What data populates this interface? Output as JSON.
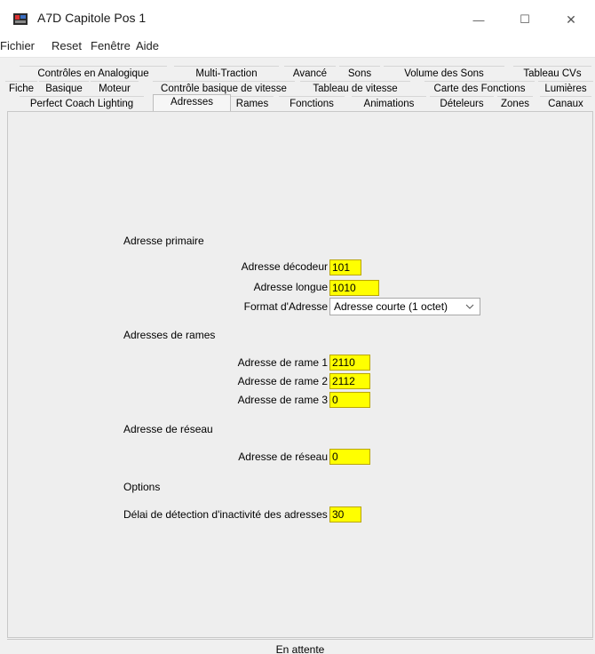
{
  "window": {
    "title": "A7D Capitole Pos 1",
    "minimize_label": "—",
    "maximize_label": "☐",
    "close_label": "✕"
  },
  "menu": [
    "Fichier",
    "Reset",
    "Fenêtre",
    "Aide"
  ],
  "tabs": {
    "row1": [
      "Contrôles en Analogique",
      "Multi-Traction",
      "Avancé",
      "Sons",
      "Volume des Sons",
      "Tableau CVs"
    ],
    "row2": [
      "Fiche",
      "Basique",
      "Moteur",
      "Contrôle basique de vitesse",
      "Tableau de vitesse",
      "Carte des Fonctions",
      "Lumières"
    ],
    "row3": [
      "Perfect Coach Lighting",
      "Adresses",
      "Rames",
      "Fonctions",
      "Animations",
      "Dételeurs",
      "Zones",
      "Canaux"
    ],
    "selected": "Adresses"
  },
  "form": {
    "primary": {
      "heading": "Adresse primaire",
      "decoder_label": "Adresse décodeur",
      "decoder_value": "101",
      "long_label": "Adresse longue",
      "long_value": "1010",
      "format_label": "Format d'Adresse",
      "format_value": "Adresse courte (1 octet)"
    },
    "consist": {
      "heading": "Adresses de rames",
      "rame1_label": "Adresse de rame 1",
      "rame1_value": "2110",
      "rame2_label": "Adresse de rame 2",
      "rame2_value": "2112",
      "rame3_label": "Adresse de rame 3",
      "rame3_value": "0"
    },
    "network": {
      "heading": "Adresse de réseau",
      "label": "Adresse de réseau",
      "value": "0"
    },
    "options": {
      "heading": "Options",
      "timeout_label": "Délai de détection d'inactivité des adresses",
      "timeout_value": "30"
    }
  },
  "status": "En attente",
  "colors": {
    "field_bg": "#ffff00"
  },
  "icons": {
    "app": "locomotive-icon",
    "select": "chevron-down-icon"
  }
}
